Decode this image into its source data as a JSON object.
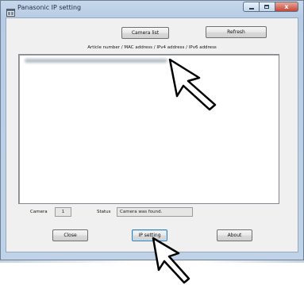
{
  "window": {
    "title": "Panasonic IP setting",
    "close_glyph": "x"
  },
  "toolbar": {
    "camera_list_label": "Camera list",
    "refresh_label": "Refresh"
  },
  "device_list": {
    "column_header": "Article number / MAC address / IPv4 address / IPv6 address",
    "first_entry_note": "blurred"
  },
  "status_bar": {
    "camera_label": "Camera",
    "camera_count": "1",
    "status_label": "Status",
    "status_text": "Camera was found."
  },
  "footer": {
    "close_label": "Close",
    "ip_setting_label": "IP setting",
    "about_label": "About"
  },
  "icons": {
    "app": "app-window-icon",
    "cursor": "arrow-cursor-icon"
  },
  "colors": {
    "window_frame": "#bfd2e7",
    "client_background": "#f0f0f0",
    "close_button": "#c84532"
  }
}
